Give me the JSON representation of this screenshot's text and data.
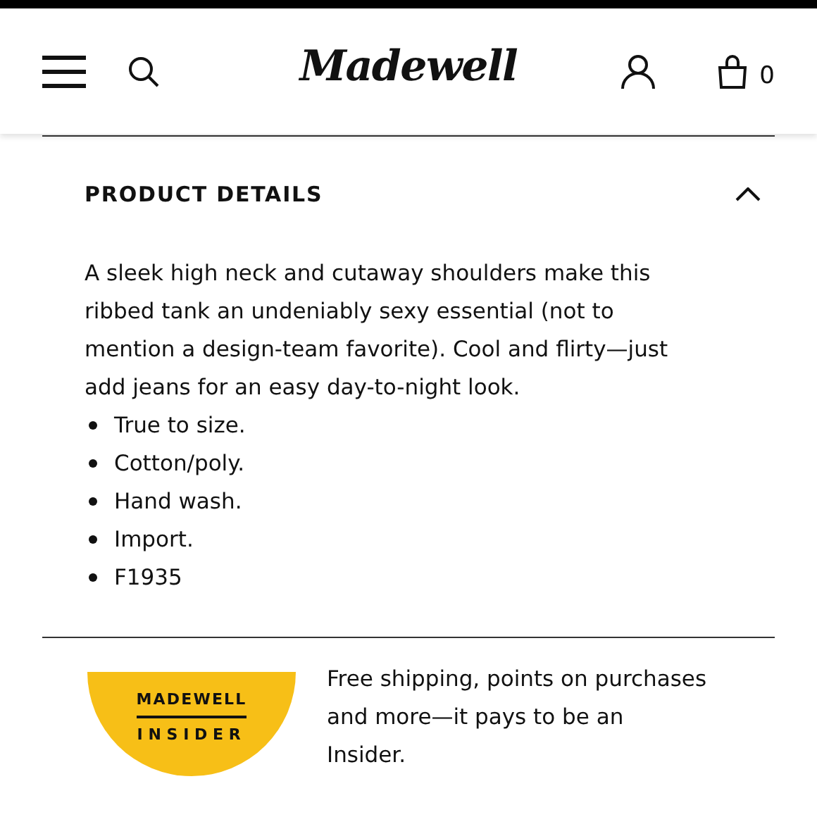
{
  "header": {
    "logo": "Madewell",
    "cart_count": "0"
  },
  "product_details": {
    "title": "PRODUCT DETAILS",
    "expanded": true,
    "description": "A sleek high neck and cutaway shoulders make this ribbed tank an undeniably sexy essential (not to mention a design-team favorite). Cool and flirty—just add jeans for an easy day-to-night look.",
    "bullets": [
      "True to size.",
      "Cotton/poly.",
      "Hand wash.",
      "Import.",
      "F1935"
    ]
  },
  "insider": {
    "badge_top": "MADEWELL",
    "badge_bottom": "INSIDER",
    "text": "Free shipping, points on purchases and more—it pays to be an Insider."
  }
}
